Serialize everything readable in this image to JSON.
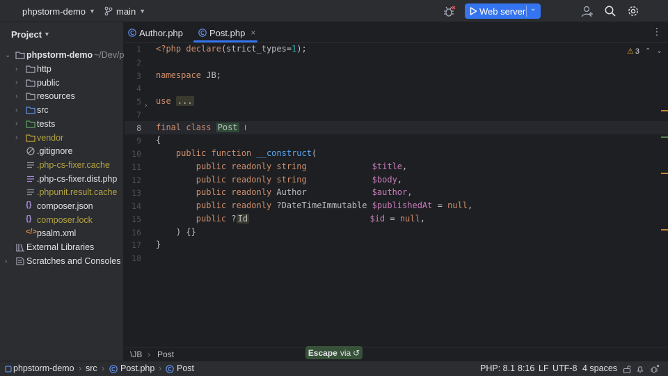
{
  "topbar": {
    "project_name": "phpstorm-demo",
    "branch": "main",
    "run_config": "Web server"
  },
  "project_panel": {
    "title": "Project",
    "root_name": "phpstorm-demo",
    "root_path": "~/Dev/p",
    "items": [
      {
        "label": "http",
        "kind": "folder",
        "color": "#dfe1e5"
      },
      {
        "label": "public",
        "kind": "folder",
        "color": "#dfe1e5"
      },
      {
        "label": "resources",
        "kind": "folder",
        "color": "#dfe1e5"
      },
      {
        "label": "src",
        "kind": "source-folder",
        "color": "#dfe1e5"
      },
      {
        "label": "tests",
        "kind": "test-folder",
        "color": "#dfe1e5"
      },
      {
        "label": "vendor",
        "kind": "excluded-folder",
        "color": "#b5a443"
      },
      {
        "label": ".gitignore",
        "kind": "ignore-file",
        "color": "#dfe1e5"
      },
      {
        "label": ".php-cs-fixer.cache",
        "kind": "text-file",
        "color": "#b5a443"
      },
      {
        "label": ".php-cs-fixer.dist.php",
        "kind": "php-file",
        "color": "#dfe1e5"
      },
      {
        "label": ".phpunit.result.cache",
        "kind": "text-file",
        "color": "#b5a443"
      },
      {
        "label": "composer.json",
        "kind": "json-file",
        "color": "#dfe1e5"
      },
      {
        "label": "composer.lock",
        "kind": "json-file",
        "color": "#b5a443"
      },
      {
        "label": "psalm.xml",
        "kind": "xml-file",
        "color": "#dfe1e5"
      }
    ],
    "external_libraries": "External Libraries",
    "scratches": "Scratches and Consoles"
  },
  "tabs": [
    {
      "label": "Author.php",
      "active": false
    },
    {
      "label": "Post.php",
      "active": true
    }
  ],
  "inspections": {
    "warnings": "3"
  },
  "code_lines": [
    {
      "n": "1",
      "tokens": [
        [
          "kw",
          "<?php "
        ],
        [
          "kw",
          "declare"
        ],
        [
          "",
          "(strict_types="
        ],
        [
          "num",
          "1"
        ],
        [
          "",
          ");"
        ]
      ]
    },
    {
      "n": "2",
      "tokens": []
    },
    {
      "n": "3",
      "tokens": [
        [
          "kw",
          "namespace "
        ],
        [
          "",
          "JB;"
        ]
      ]
    },
    {
      "n": "4",
      "tokens": []
    },
    {
      "n": "5",
      "tokens": [
        [
          "kw",
          "use "
        ],
        [
          "fold",
          "..."
        ]
      ]
    },
    {
      "n": "7",
      "tokens": []
    },
    {
      "n": "8",
      "tokens": [
        [
          "kw",
          "final class "
        ],
        [
          "hl",
          "Post"
        ]
      ]
    },
    {
      "n": "9",
      "tokens": [
        [
          "",
          "{"
        ]
      ]
    },
    {
      "n": "10",
      "tokens": [
        [
          "",
          "    "
        ],
        [
          "kw",
          "public function "
        ],
        [
          "fn",
          "__construct"
        ],
        [
          "",
          "("
        ]
      ]
    },
    {
      "n": "11",
      "tokens": [
        [
          "",
          "        "
        ],
        [
          "kw",
          "public readonly string             "
        ],
        [
          "var",
          "$title"
        ],
        [
          "",
          ","
        ]
      ]
    },
    {
      "n": "12",
      "tokens": [
        [
          "",
          "        "
        ],
        [
          "kw",
          "public readonly string             "
        ],
        [
          "var",
          "$body"
        ],
        [
          "",
          ","
        ]
      ]
    },
    {
      "n": "13",
      "tokens": [
        [
          "",
          "        "
        ],
        [
          "kw",
          "public readonly "
        ],
        [
          "",
          "Author             "
        ],
        [
          "var",
          "$author"
        ],
        [
          "",
          ","
        ]
      ]
    },
    {
      "n": "14",
      "tokens": [
        [
          "",
          "        "
        ],
        [
          "kw",
          "public readonly "
        ],
        [
          "",
          "?DateTimeImmutable "
        ],
        [
          "var",
          "$publishedAt"
        ],
        [
          "",
          " = "
        ],
        [
          "kw",
          "null"
        ],
        [
          "",
          ","
        ]
      ]
    },
    {
      "n": "15",
      "tokens": [
        [
          "",
          "        "
        ],
        [
          "kw",
          "public "
        ],
        [
          "",
          "?"
        ],
        [
          "fold",
          "Id"
        ],
        [
          "",
          "                        "
        ],
        [
          "var",
          "$id"
        ],
        [
          "",
          " = "
        ],
        [
          "kw",
          "null"
        ],
        [
          "",
          ","
        ]
      ]
    },
    {
      "n": "16",
      "tokens": [
        [
          "",
          "    ) {}"
        ]
      ]
    },
    {
      "n": "17",
      "tokens": [
        [
          "",
          "}"
        ]
      ]
    },
    {
      "n": "18",
      "tokens": []
    }
  ],
  "editor_breadcrumbs": {
    "namespace": "\\JB",
    "class": "Post"
  },
  "escape_toast": {
    "key": "Escape",
    "suffix": "via"
  },
  "statusbar": {
    "crumbs": [
      "phpstorm-demo",
      "src",
      "Post.php",
      "Post"
    ],
    "php_version": "PHP: 8.1",
    "position": "8:16",
    "line_sep": "LF",
    "encoding": "UTF-8",
    "indent": "4 spaces"
  },
  "colors": {
    "accent": "#3574f0",
    "keyword": "#cf8e6d",
    "function": "#56a8f5",
    "variable": "#c77dbb",
    "ignored_file": "#b5a443"
  }
}
